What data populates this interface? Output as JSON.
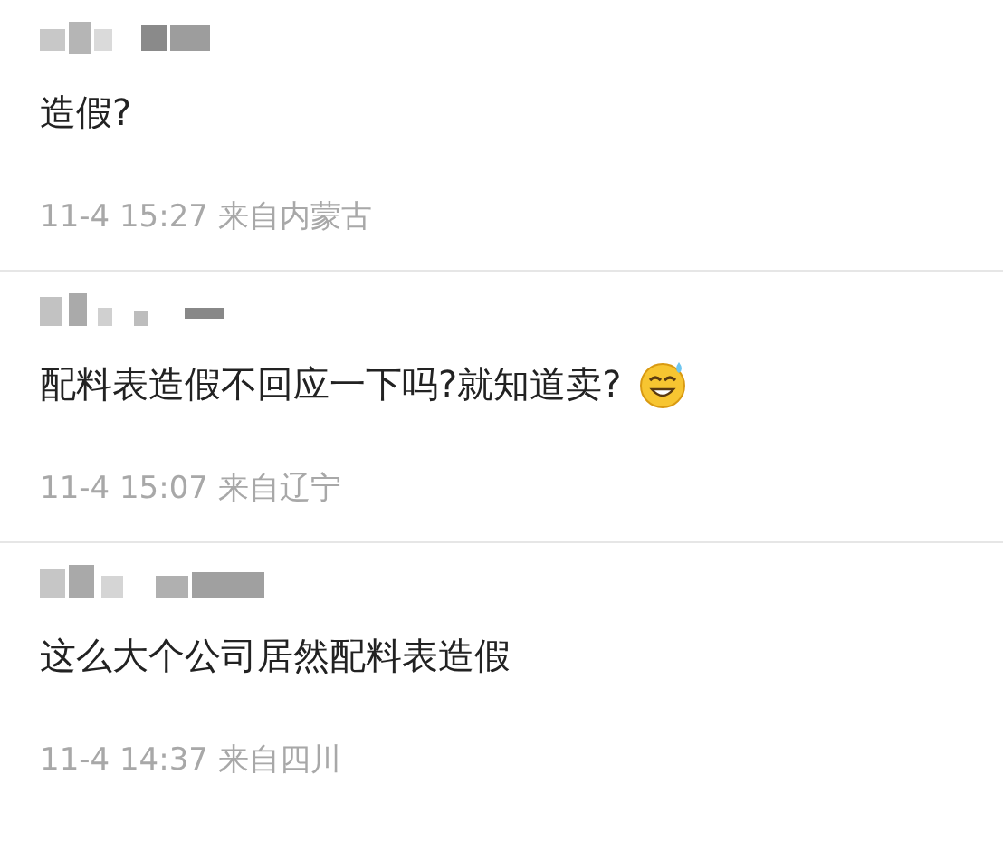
{
  "comments": [
    {
      "text": "造假?",
      "meta": "11-4 15:27 来自内蒙古",
      "has_emoji": false
    },
    {
      "text": "配料表造假不回应一下吗?就知道卖?",
      "meta": "11-4 15:07 来自辽宁",
      "has_emoji": true
    },
    {
      "text": "这么大个公司居然配料表造假",
      "meta": "11-4 14:37 来自四川",
      "has_emoji": false
    }
  ]
}
